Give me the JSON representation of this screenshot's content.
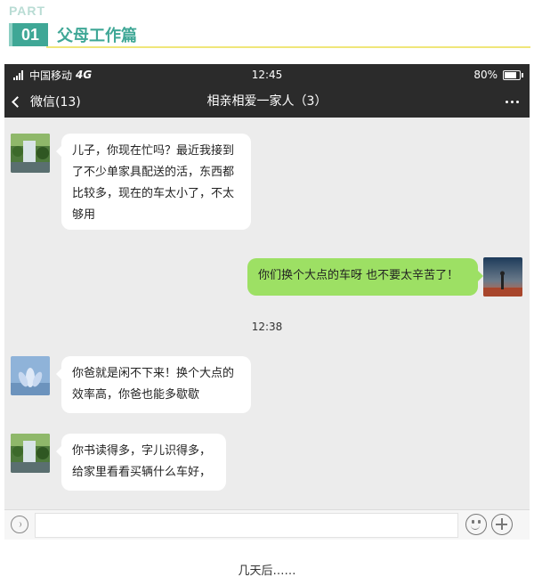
{
  "header": {
    "part_label": "PART",
    "number": "01",
    "title": "父母工作篇"
  },
  "statusbar": {
    "carrier": "中国移动",
    "network": "4G",
    "time": "12:45",
    "battery": "80%"
  },
  "navbar": {
    "back_label": "微信(13)",
    "title": "相亲相爱一家人（3）"
  },
  "messages": [
    {
      "side": "left",
      "avatar": "waterfall-avatar-icon",
      "text": "儿子，你现在忙吗？最近我接到了不少单家具配送的活，东西都比较多，现在的车太小了，不太够用"
    },
    {
      "side": "right",
      "avatar": "sunset-avatar-icon",
      "text": "你们换个大点的车呀  也不要太辛苦了！"
    },
    {
      "side": "left",
      "avatar": "lotus-avatar-icon",
      "text": "你爸就是闲不下来！换个大点的效率高，你爸也能多歇歇"
    },
    {
      "side": "left",
      "avatar": "waterfall-avatar-icon",
      "text": "你书读得多，字儿识得多，给家里看看买辆什么车好，"
    }
  ],
  "timestamp": "12:38",
  "caption": "几天后……",
  "colors": {
    "accent": "#3fa796",
    "bubble_sent": "#9de064",
    "chat_bg": "#ececec",
    "bar": "#2b2b2b"
  }
}
